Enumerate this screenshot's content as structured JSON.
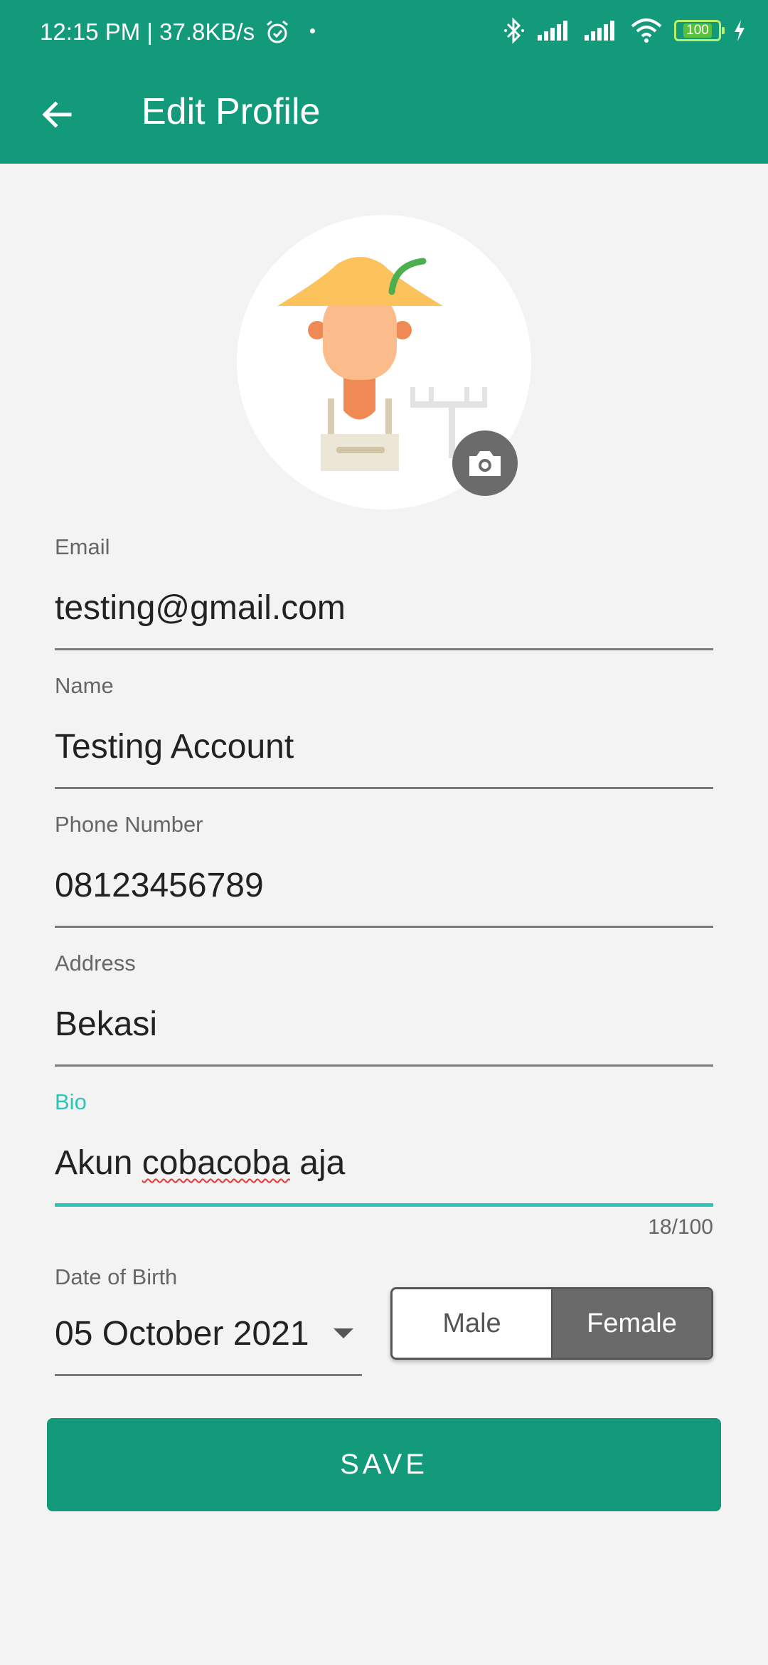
{
  "status_bar": {
    "time_speed": "12:15 PM | 37.8KB/s",
    "battery_level": "100"
  },
  "header": {
    "title": "Edit Profile"
  },
  "fields": {
    "email": {
      "label": "Email",
      "value": "testing@gmail.com"
    },
    "name": {
      "label": "Name",
      "value": "Testing Account"
    },
    "phone": {
      "label": "Phone Number",
      "value": "08123456789"
    },
    "address": {
      "label": "Address",
      "value": "Bekasi"
    },
    "bio": {
      "label": "Bio",
      "value_prefix": "Akun ",
      "value_misspelled": "cobacoba",
      "value_suffix": " aja",
      "counter": "18/100"
    }
  },
  "dob": {
    "label": "Date of Birth",
    "value": "05 October 2021"
  },
  "gender": {
    "male_label": "Male",
    "female_label": "Female",
    "selected": "Female"
  },
  "save_label": "SAVE",
  "colors": {
    "primary": "#139a7b",
    "accent": "#2ec4b6",
    "background": "#f3f3f3"
  },
  "icons": {
    "back": "arrow-left-icon",
    "camera": "camera-icon",
    "alarm": "alarm-icon",
    "bluetooth": "bluetooth-icon",
    "signal": "signal-icon",
    "wifi": "wifi-icon",
    "charging": "charging-icon"
  }
}
